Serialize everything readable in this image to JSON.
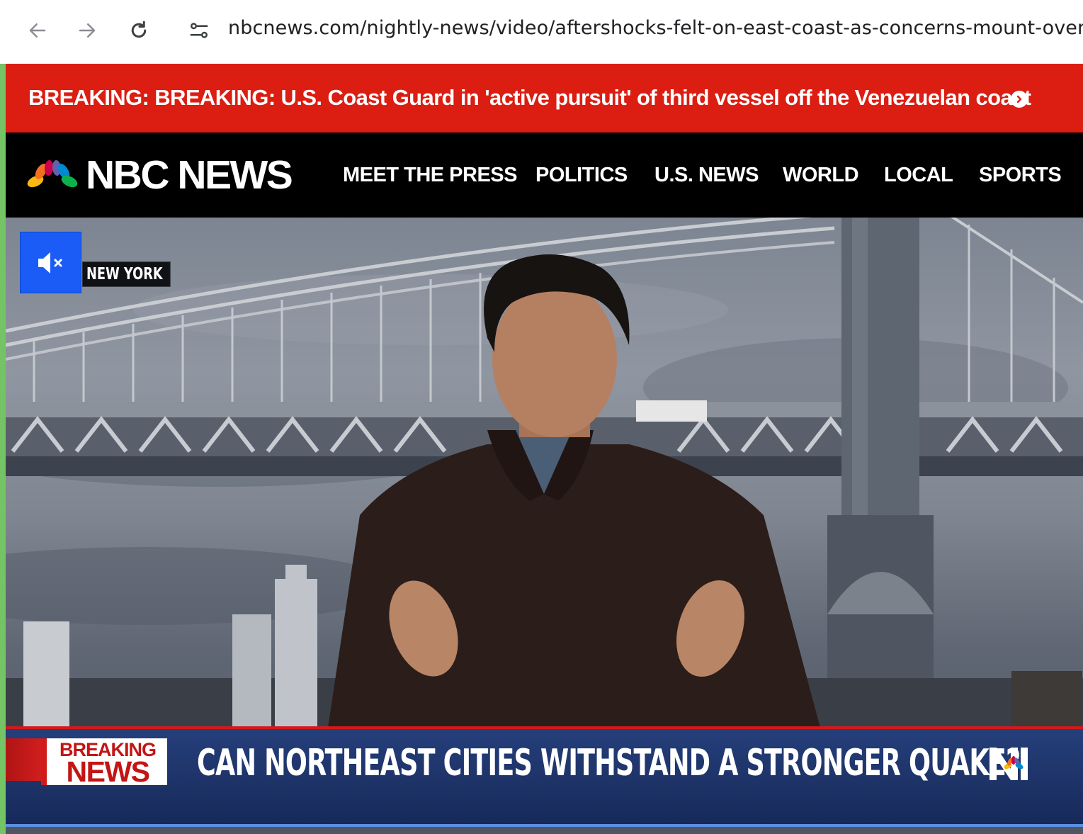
{
  "browser": {
    "url": "nbcnews.com/nightly-news/video/aftershocks-felt-on-east-coast-as-concerns-mount-over",
    "back_icon": "arrow-left-icon",
    "forward_icon": "arrow-right-icon",
    "reload_icon": "reload-icon",
    "site_settings_icon": "tune-icon"
  },
  "breaking_banner": {
    "text": "BREAKING: BREAKING: U.S. Coast Guard in 'active pursuit' of third vessel off the Venezuelan coast",
    "icon": "chevron-right-circle-icon",
    "color": "#db1d12"
  },
  "header": {
    "logo_text": "NBC NEWS",
    "nav": [
      {
        "label": "MEET THE PRESS"
      },
      {
        "label": "POLITICS"
      },
      {
        "label": "U.S. NEWS"
      },
      {
        "label": "WORLD"
      },
      {
        "label": "LOCAL"
      },
      {
        "label": "SPORTS"
      }
    ]
  },
  "video": {
    "location": "NEW YORK",
    "mute_icon": "volume-muted-icon",
    "lower_third": {
      "badge_line1": "BREAKING",
      "badge_line2": "NEWS",
      "headline": "CAN NORTHEAST CITIES WITHSTAND A STRONGER QUAKE?"
    }
  },
  "colors": {
    "accent_blue": "#1a5cf5",
    "lower_third_blue": "#1d3266",
    "breaking_red": "#d11a1a"
  }
}
